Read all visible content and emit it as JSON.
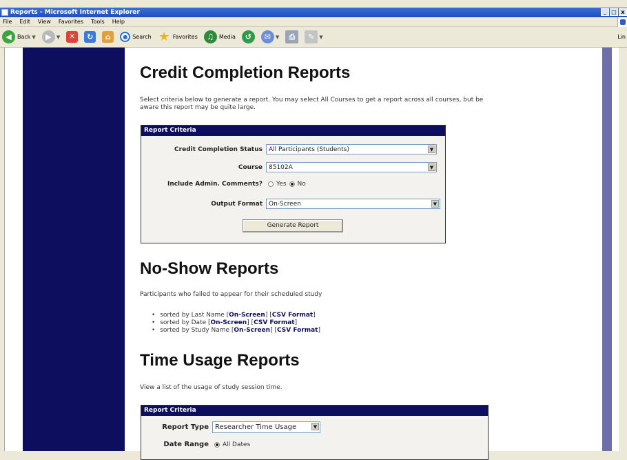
{
  "window": {
    "title": "Reports - Microsoft Internet Explorer",
    "controls": [
      "_",
      "□",
      "x"
    ]
  },
  "menu": [
    "File",
    "Edit",
    "View",
    "Favorites",
    "Tools",
    "Help"
  ],
  "toolbar": {
    "back": "Back",
    "search": "Search",
    "favorites": "Favorites",
    "media": "Media",
    "links": "Lin"
  },
  "credit": {
    "title": "Credit Completion Reports",
    "description_line1": "Select criteria below to generate a report. You may select All Courses to get a report across all courses, but be",
    "description_line2": "aware this report may be quite large.",
    "panel_title": "Report Criteria",
    "status_label": "Credit Completion Status",
    "status_value": "All Participants (Students)",
    "course_label": "Course",
    "course_value": "85102A",
    "comments_label": "Include Admin. Comments?",
    "yes": "Yes",
    "no": "No",
    "comments_selected": "No",
    "format_label": "Output Format",
    "format_value": "On-Screen",
    "generate": "Generate Report"
  },
  "noshow": {
    "title": "No-Show Reports",
    "description": "Participants who failed to appear for their scheduled study",
    "items": [
      {
        "prefix": "sorted by Last Name [",
        "onscreen": "On-Screen",
        "mid": "] [",
        "csv": "CSV Format",
        "suffix": "]"
      },
      {
        "prefix": "sorted by Date [",
        "onscreen": "On-Screen",
        "mid": "] [",
        "csv": "CSV Format",
        "suffix": "]"
      },
      {
        "prefix": "sorted by Study Name [",
        "onscreen": "On-Screen",
        "mid": "] [",
        "csv": "CSV Format",
        "suffix": "]"
      }
    ]
  },
  "time": {
    "title": "Time Usage Reports",
    "description": "View a list of the usage of study session time.",
    "panel_title": "Report Criteria",
    "type_label": "Report Type",
    "type_value": "Researcher Time Usage",
    "range_label": "Date Range",
    "range_value": "All Dates"
  }
}
